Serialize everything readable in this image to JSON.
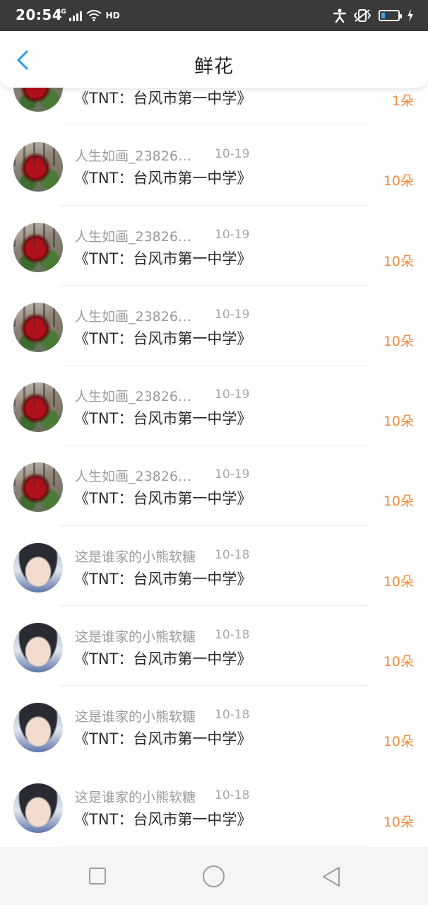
{
  "status_bar": {
    "time": "20:54",
    "network": "4G",
    "hd": "HD",
    "icons": [
      "signal-icon",
      "wifi-icon",
      "hd-icon",
      "accessibility-icon",
      "vibrate-icon",
      "battery-icon",
      "charging-icon"
    ],
    "battery_level": 0.15,
    "battery_color": "#39a8f0"
  },
  "header": {
    "back_icon": "chevron-left-icon",
    "title": "鲜花",
    "accent_color": "#2a9de4"
  },
  "list": {
    "accent_count_color": "#f08a3c",
    "items": [
      {
        "avatar": "rose",
        "user": "",
        "date": "",
        "book": "《TNT：台风市第一中学》",
        "count": "1朵"
      },
      {
        "avatar": "rose",
        "user": "人生如画_238264...",
        "date": "10-19",
        "book": "《TNT：台风市第一中学》",
        "count": "10朵"
      },
      {
        "avatar": "rose",
        "user": "人生如画_238264...",
        "date": "10-19",
        "book": "《TNT：台风市第一中学》",
        "count": "10朵"
      },
      {
        "avatar": "rose",
        "user": "人生如画_238264...",
        "date": "10-19",
        "book": "《TNT：台风市第一中学》",
        "count": "10朵"
      },
      {
        "avatar": "rose",
        "user": "人生如画_238264...",
        "date": "10-19",
        "book": "《TNT：台风市第一中学》",
        "count": "10朵"
      },
      {
        "avatar": "rose",
        "user": "人生如画_238264...",
        "date": "10-19",
        "book": "《TNT：台风市第一中学》",
        "count": "10朵"
      },
      {
        "avatar": "boy",
        "user": "这是谁家的小熊软糖",
        "date": "10-18",
        "book": "《TNT：台风市第一中学》",
        "count": "10朵"
      },
      {
        "avatar": "boy",
        "user": "这是谁家的小熊软糖",
        "date": "10-18",
        "book": "《TNT：台风市第一中学》",
        "count": "10朵"
      },
      {
        "avatar": "boy",
        "user": "这是谁家的小熊软糖",
        "date": "10-18",
        "book": "《TNT：台风市第一中学》",
        "count": "10朵"
      },
      {
        "avatar": "boy",
        "user": "这是谁家的小熊软糖",
        "date": "10-18",
        "book": "《TNT：台风市第一中学》",
        "count": "10朵"
      }
    ]
  },
  "nav_bar": {
    "icons": [
      "recent-apps-icon",
      "home-icon",
      "back-icon"
    ]
  }
}
